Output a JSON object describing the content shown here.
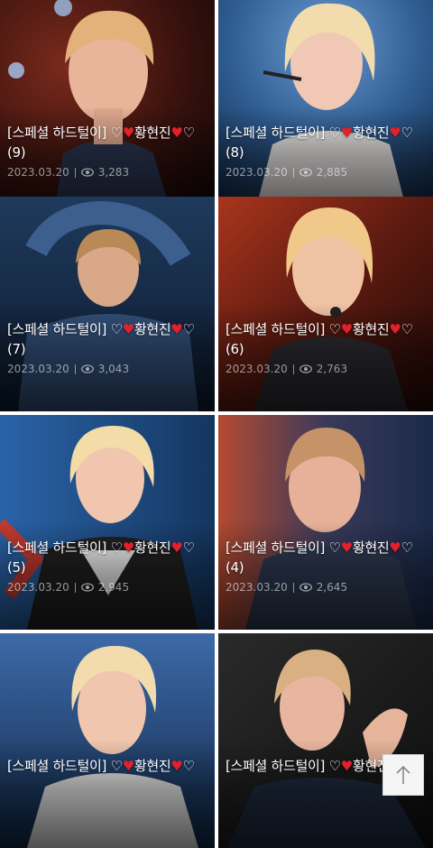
{
  "posts": [
    {
      "title_prefix": "[스페셜 하드털이] ♡",
      "heart": "♥",
      "name": "황현진",
      "heart2": "♥",
      "title_suffix": "♡",
      "number": "(9)",
      "date": "2023.03.20",
      "views": "3,283"
    },
    {
      "title_prefix": "[스페셜 하드털이] ♡",
      "heart": "♥",
      "name": "황현진",
      "heart2": "♥",
      "title_suffix": "♡",
      "number": "(8)",
      "date": "2023.03.20",
      "views": "2,885"
    },
    {
      "title_prefix": "[스페셜 하드털이] ♡",
      "heart": "♥",
      "name": "황현진",
      "heart2": "♥",
      "title_suffix": "♡",
      "number": "(7)",
      "date": "2023.03.20",
      "views": "3,043"
    },
    {
      "title_prefix": "[스페셜 하드털이] ♡",
      "heart": "♥",
      "name": "황현진",
      "heart2": "♥",
      "title_suffix": "♡",
      "number": "(6)",
      "date": "2023.03.20",
      "views": "2,763"
    },
    {
      "title_prefix": "[스페셜 하드털이] ♡",
      "heart": "♥",
      "name": "황현진",
      "heart2": "♥",
      "title_suffix": "♡",
      "number": "(5)",
      "date": "2023.03.20",
      "views": "2,945"
    },
    {
      "title_prefix": "[스페셜 하드털이] ♡",
      "heart": "♥",
      "name": "황현진",
      "heart2": "♥",
      "title_suffix": "♡",
      "number": "(4)",
      "date": "2023.03.20",
      "views": "2,645"
    },
    {
      "title_prefix": "[스페셜 하드털이] ♡",
      "heart": "♥",
      "name": "황현진",
      "heart2": "♥",
      "title_suffix": "♡"
    },
    {
      "title_prefix": "[스페셜 하드털이] ♡",
      "heart": "♥",
      "name": "황현진",
      "heart2": "♥",
      "title_suffix": "♡"
    }
  ],
  "scroll_top_icon": "arrow-up-icon",
  "colors": {
    "heart": "#e3212b",
    "meta": "#b8b8b8"
  }
}
